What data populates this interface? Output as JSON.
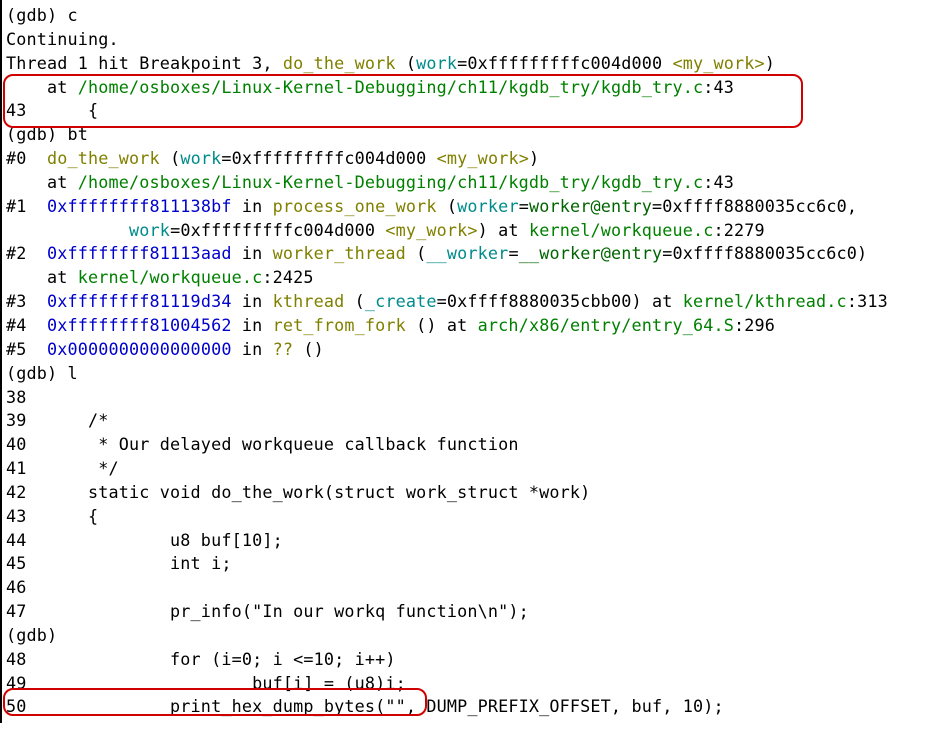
{
  "lines": {
    "l1": "(gdb) c",
    "l2": "Continuing.",
    "l3": "",
    "l4_a": "Thread 1 hit Breakpoint 3, ",
    "l4_b": "do_the_work",
    "l4_c": " (",
    "l4_d": "work",
    "l4_e": "=0xfffffffffc004d000 ",
    "l4_f": "<my_work>",
    "l4_g": ")",
    "l5_a": "    at ",
    "l5_b": "/home/osboxes/Linux-Kernel-Debugging/ch11/kgdb_try/kgdb_try.c",
    "l5_c": ":43",
    "l6": "43      {",
    "l7": "(gdb) bt",
    "l8_a": "#0  ",
    "l8_b": "do_the_work",
    "l8_c": " (",
    "l8_d": "work",
    "l8_e": "=0xfffffffffc004d000 ",
    "l8_f": "<my_work>",
    "l8_g": ")",
    "l9_a": "    at ",
    "l9_b": "/home/osboxes/Linux-Kernel-Debugging/ch11/kgdb_try/kgdb_try.c",
    "l9_c": ":43",
    "l10_a": "#1  ",
    "l10_b": "0xffffffff811138bf",
    "l10_c": " in ",
    "l10_d": "process_one_work",
    "l10_e": " (",
    "l10_f": "worker",
    "l10_g": "=",
    "l10_h": "worker@entry",
    "l10_i": "=0xffff8880035cc6c0,",
    "l11_a": "    ",
    "l11_b": "            work",
    "l11_c": "=0xfffffffffc004d000 ",
    "l11_d": "<my_work>",
    "l11_e": ") at ",
    "l11_f": "kernel/workqueue.c",
    "l11_g": ":2279",
    "l12_a": "#2  ",
    "l12_b": "0xffffffff81113aad",
    "l12_c": " in ",
    "l12_d": "worker_thread",
    "l12_e": " (",
    "l12_f": "__worker",
    "l12_g": "=",
    "l12_h": "__worker@entry",
    "l12_i": "=0xffff8880035cc6c0)",
    "l13_a": "    at ",
    "l13_b": "kernel/workqueue.c",
    "l13_c": ":2425",
    "l14_a": "#3  ",
    "l14_b": "0xffffffff81119d34",
    "l14_c": " in ",
    "l14_d": "kthread",
    "l14_e": " (",
    "l14_f": "_create",
    "l14_g": "=0xffff8880035cbb00) at ",
    "l14_h": "kernel/kthread.c",
    "l14_i": ":313",
    "l15_a": "#4  ",
    "l15_b": "0xffffffff81004562",
    "l15_c": " in ",
    "l15_d": "ret_from_fork",
    "l15_e": " () at ",
    "l15_f": "arch/x86/entry/entry_64.S",
    "l15_g": ":296",
    "l16_a": "#5  ",
    "l16_b": "0x0000000000000000",
    "l16_c": " in ",
    "l16_d": "??",
    "l16_e": " ()",
    "l17": "(gdb) l",
    "l18": "38",
    "l19": "39      /*",
    "l20": "40       * Our delayed workqueue callback function",
    "l21": "41       */",
    "l22": "42      static void do_the_work(struct work_struct *work)",
    "l23": "43      {",
    "l24": "44              u8 buf[10];",
    "l25": "45              int i;",
    "l26": "46",
    "l27": "47              pr_info(\"In our workq function\\n\");",
    "l28": "(gdb)",
    "l29": "48              for (i=0; i <=10; i++)",
    "l30": "49                      buf[i] = (u8)i;",
    "l31": "50              print_hex_dump_bytes(\"\", DUMP_PREFIX_OFFSET, buf, 10);"
  }
}
